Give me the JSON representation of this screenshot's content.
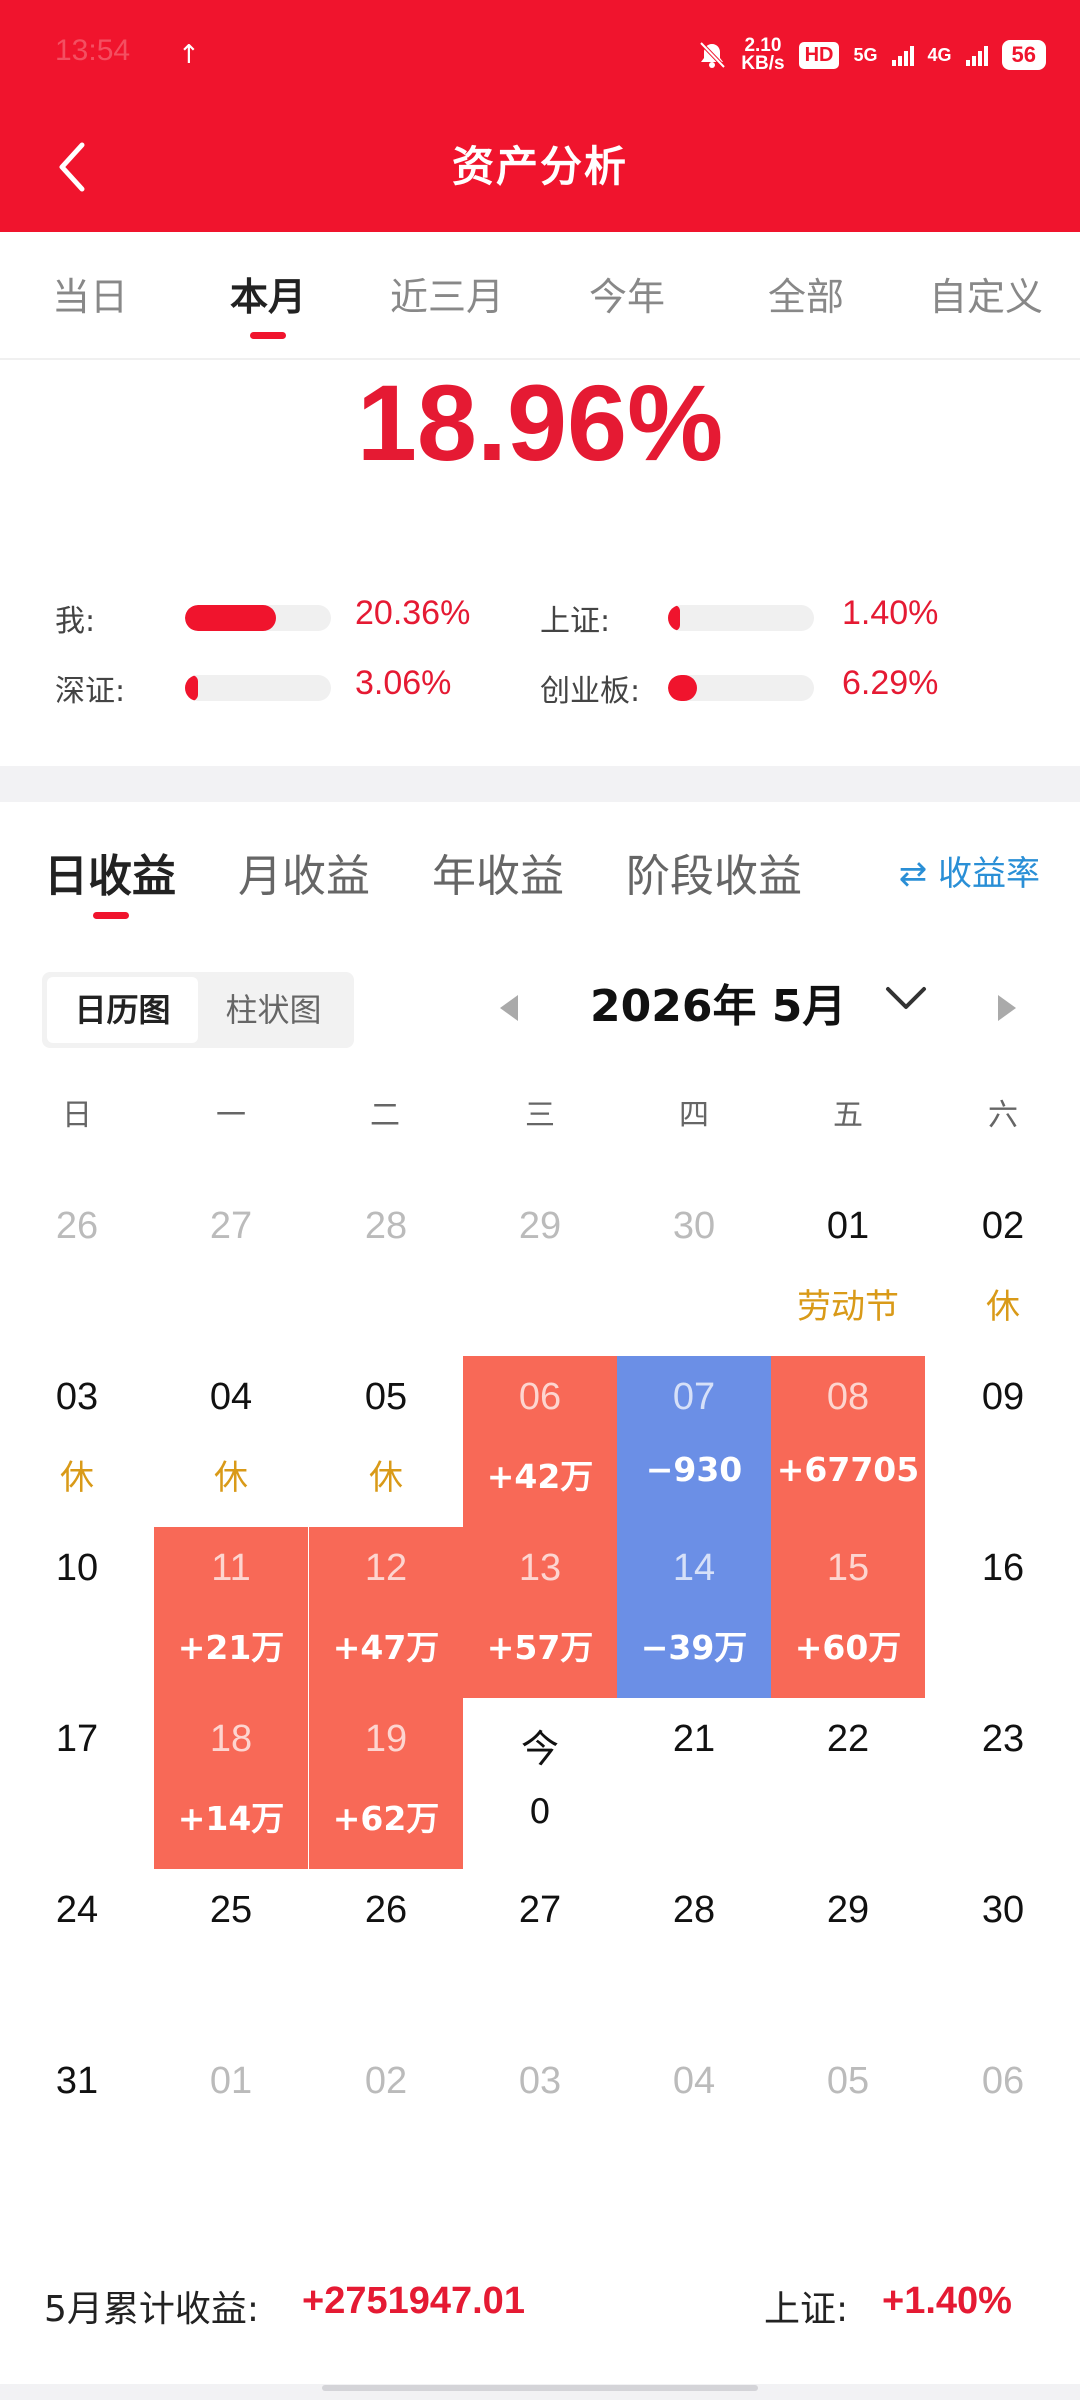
{
  "status_bar": {
    "time": "13:54",
    "net_speed_value": "2.10",
    "net_speed_unit": "KB/s",
    "hd_label": "HD",
    "sig1": "5G",
    "sig2": "4G",
    "battery": "56"
  },
  "header": {
    "title": "资产分析",
    "accent_color": "#f0142d"
  },
  "period_tabs": [
    {
      "label": "当日",
      "active": false
    },
    {
      "label": "本月",
      "active": true
    },
    {
      "label": "近三月",
      "active": false
    },
    {
      "label": "今年",
      "active": false
    },
    {
      "label": "全部",
      "active": false
    },
    {
      "label": "自定义",
      "active": false
    }
  ],
  "summary": {
    "return_pct": "18.96%"
  },
  "comparisons": [
    {
      "label": "我:",
      "value": "20.36%",
      "level": 0.62
    },
    {
      "label": "上证:",
      "value": "1.40%",
      "level": 0.05
    },
    {
      "label": "深证:",
      "value": "3.06%",
      "level": 0.09
    },
    {
      "label": "创业板:",
      "value": "6.29%",
      "level": 0.2
    }
  ],
  "earnings_tabs": [
    {
      "label": "日收益",
      "active": true
    },
    {
      "label": "月收益",
      "active": false
    },
    {
      "label": "年收益",
      "active": false
    },
    {
      "label": "阶段收益",
      "active": false
    }
  ],
  "rate_toggle": {
    "icon": "swap-icon",
    "label": "收益率"
  },
  "view_toggle": [
    {
      "label": "日历图",
      "active": true
    },
    {
      "label": "柱状图",
      "active": false
    }
  ],
  "month_nav": {
    "label": "2026年 5月"
  },
  "weekdays": [
    "日",
    "一",
    "二",
    "三",
    "四",
    "五",
    "六"
  ],
  "calendar": {
    "gain_color": "#f86957",
    "loss_color": "#6b8fe6",
    "holiday_color": "#d99a18",
    "weeks": [
      [
        {
          "day": "26",
          "sub": "",
          "type": "other"
        },
        {
          "day": "27",
          "sub": "",
          "type": "other"
        },
        {
          "day": "28",
          "sub": "",
          "type": "other"
        },
        {
          "day": "29",
          "sub": "",
          "type": "other"
        },
        {
          "day": "30",
          "sub": "",
          "type": "other"
        },
        {
          "day": "01",
          "sub": "劳动节",
          "type": "holiday"
        },
        {
          "day": "02",
          "sub": "休",
          "type": "holiday"
        }
      ],
      [
        {
          "day": "03",
          "sub": "休",
          "type": "holiday"
        },
        {
          "day": "04",
          "sub": "休",
          "type": "holiday"
        },
        {
          "day": "05",
          "sub": "休",
          "type": "holiday"
        },
        {
          "day": "06",
          "sub": "+42万",
          "type": "gain"
        },
        {
          "day": "07",
          "sub": "−930",
          "type": "loss"
        },
        {
          "day": "08",
          "sub": "+67705",
          "type": "gain"
        },
        {
          "day": "09",
          "sub": "",
          "type": "normal"
        }
      ],
      [
        {
          "day": "10",
          "sub": "",
          "type": "normal"
        },
        {
          "day": "11",
          "sub": "+21万",
          "type": "gain"
        },
        {
          "day": "12",
          "sub": "+47万",
          "type": "gain"
        },
        {
          "day": "13",
          "sub": "+57万",
          "type": "gain"
        },
        {
          "day": "14",
          "sub": "−39万",
          "type": "loss"
        },
        {
          "day": "15",
          "sub": "+60万",
          "type": "gain"
        },
        {
          "day": "16",
          "sub": "",
          "type": "normal"
        }
      ],
      [
        {
          "day": "17",
          "sub": "",
          "type": "normal"
        },
        {
          "day": "18",
          "sub": "+14万",
          "type": "gain"
        },
        {
          "day": "19",
          "sub": "+62万",
          "type": "gain"
        },
        {
          "day": "今",
          "sub": "0",
          "type": "today"
        },
        {
          "day": "21",
          "sub": "",
          "type": "normal"
        },
        {
          "day": "22",
          "sub": "",
          "type": "normal"
        },
        {
          "day": "23",
          "sub": "",
          "type": "normal"
        }
      ],
      [
        {
          "day": "24",
          "sub": "",
          "type": "normal"
        },
        {
          "day": "25",
          "sub": "",
          "type": "normal"
        },
        {
          "day": "26",
          "sub": "",
          "type": "normal"
        },
        {
          "day": "27",
          "sub": "",
          "type": "normal"
        },
        {
          "day": "28",
          "sub": "",
          "type": "normal"
        },
        {
          "day": "29",
          "sub": "",
          "type": "normal"
        },
        {
          "day": "30",
          "sub": "",
          "type": "normal"
        }
      ],
      [
        {
          "day": "31",
          "sub": "",
          "type": "normal"
        },
        {
          "day": "01",
          "sub": "",
          "type": "other"
        },
        {
          "day": "02",
          "sub": "",
          "type": "other"
        },
        {
          "day": "03",
          "sub": "",
          "type": "other"
        },
        {
          "day": "04",
          "sub": "",
          "type": "other"
        },
        {
          "day": "05",
          "sub": "",
          "type": "other"
        },
        {
          "day": "06",
          "sub": "",
          "type": "other"
        }
      ]
    ]
  },
  "footer": {
    "sum_label": "5月累计收益:",
    "sum_value": "+2751947.01",
    "index_label": "上证:",
    "index_value": "+1.40%"
  }
}
